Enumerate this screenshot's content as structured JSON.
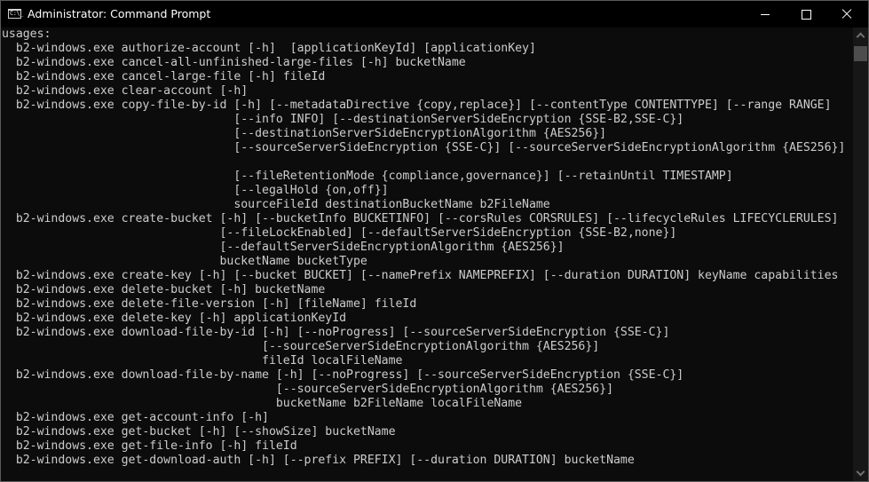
{
  "window": {
    "title": "Administrator: Command Prompt",
    "icon": "cmd-icon",
    "icon_text": "C:\\_",
    "controls": [
      "minimize",
      "maximize",
      "close"
    ]
  },
  "console": {
    "background": "#0c0c0c",
    "foreground": "#cccccc",
    "lines": [
      "usages:",
      "  b2-windows.exe authorize-account [-h]  [applicationKeyId] [applicationKey]",
      "  b2-windows.exe cancel-all-unfinished-large-files [-h] bucketName",
      "  b2-windows.exe cancel-large-file [-h] fileId",
      "  b2-windows.exe clear-account [-h]",
      "  b2-windows.exe copy-file-by-id [-h] [--metadataDirective {copy,replace}] [--contentType CONTENTTYPE] [--range RANGE]",
      "                                 [--info INFO] [--destinationServerSideEncryption {SSE-B2,SSE-C}]",
      "                                 [--destinationServerSideEncryptionAlgorithm {AES256}]",
      "                                 [--sourceServerSideEncryption {SSE-C}] [--sourceServerSideEncryptionAlgorithm {AES256}]",
      "",
      "                                 [--fileRetentionMode {compliance,governance}] [--retainUntil TIMESTAMP]",
      "                                 [--legalHold {on,off}]",
      "                                 sourceFileId destinationBucketName b2FileName",
      "  b2-windows.exe create-bucket [-h] [--bucketInfo BUCKETINFO] [--corsRules CORSRULES] [--lifecycleRules LIFECYCLERULES]",
      "                               [--fileLockEnabled] [--defaultServerSideEncryption {SSE-B2,none}]",
      "                               [--defaultServerSideEncryptionAlgorithm {AES256}]",
      "                               bucketName bucketType",
      "  b2-windows.exe create-key [-h] [--bucket BUCKET] [--namePrefix NAMEPREFIX] [--duration DURATION] keyName capabilities",
      "  b2-windows.exe delete-bucket [-h] bucketName",
      "  b2-windows.exe delete-file-version [-h] [fileName] fileId",
      "  b2-windows.exe delete-key [-h] applicationKeyId",
      "  b2-windows.exe download-file-by-id [-h] [--noProgress] [--sourceServerSideEncryption {SSE-C}]",
      "                                     [--sourceServerSideEncryptionAlgorithm {AES256}]",
      "                                     fileId localFileName",
      "  b2-windows.exe download-file-by-name [-h] [--noProgress] [--sourceServerSideEncryption {SSE-C}]",
      "                                       [--sourceServerSideEncryptionAlgorithm {AES256}]",
      "                                       bucketName b2FileName localFileName",
      "  b2-windows.exe get-account-info [-h]",
      "  b2-windows.exe get-bucket [-h] [--showSize] bucketName",
      "  b2-windows.exe get-file-info [-h] fileId",
      "  b2-windows.exe get-download-auth [-h] [--prefix PREFIX] [--duration DURATION] bucketName"
    ]
  },
  "scrollbar": {
    "position_fraction": 0.0
  }
}
